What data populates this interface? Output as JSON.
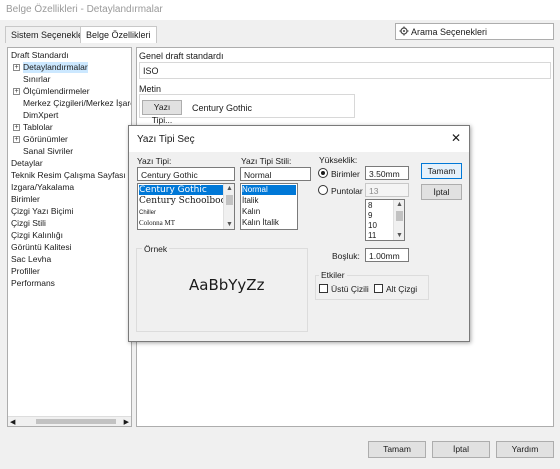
{
  "window": {
    "title": "Belge Özellikleri - Detaylandırmalar"
  },
  "tabs": [
    {
      "label": "Sistem Seçenekleri"
    },
    {
      "label": "Belge Özellikleri"
    }
  ],
  "search": {
    "placeholder": "Arama Seçenekleri"
  },
  "tree": [
    {
      "label": "Draft Standardı"
    },
    {
      "label": "Detaylandırmalar"
    },
    {
      "label": "Sınırlar"
    },
    {
      "label": "Ölçümlendirmeler"
    },
    {
      "label": "Merkez Çizgileri/Merkez İşare"
    },
    {
      "label": "DimXpert"
    },
    {
      "label": "Tablolar"
    },
    {
      "label": "Görünümler"
    },
    {
      "label": "Sanal Sivriler"
    },
    {
      "label": "Detaylar"
    },
    {
      "label": "Teknik Resim Çalışma Sayfası"
    },
    {
      "label": "Izgara/Yakalama"
    },
    {
      "label": "Birimler"
    },
    {
      "label": "Çizgi Yazı Biçimi"
    },
    {
      "label": "Çizgi Stili"
    },
    {
      "label": "Çizgi Kalınlığı"
    },
    {
      "label": "Görüntü Kalitesi"
    },
    {
      "label": "Sac Levha"
    },
    {
      "label": "Profiller"
    },
    {
      "label": "Performans"
    }
  ],
  "main": {
    "general_label": "Genel draft standardı",
    "general_value": "ISO",
    "text_label": "Metin",
    "font_button": "Yazı Tipi...",
    "font_value": "Century Gothic"
  },
  "dialog": {
    "title": "Yazı Tipi Seç",
    "font_label": "Yazı Tipi:",
    "font_value": "Century Gothic",
    "fonts": [
      "Century Gothic",
      "Century Schoolbook",
      "Chiller",
      "Colonna MT"
    ],
    "style_label": "Yazı Tipi Stili:",
    "style_value": "Normal",
    "styles": [
      "Normal",
      "İtalik",
      "Kalın",
      "Kalın İtalik"
    ],
    "height_label": "Yükseklik:",
    "units_label": "Birimler",
    "units_value": "3.50mm",
    "points_label": "Puntolar",
    "points_value": "13",
    "points_list": [
      "8",
      "9",
      "10",
      "11"
    ],
    "spacing_label": "Boşluk:",
    "spacing_value": "1.00mm",
    "preview_label": "Örnek",
    "preview_text": "AaBbYyZz",
    "effects_label": "Etkiler",
    "strike_label": "Üstü Çizili",
    "underline_label": "Alt Çizgi",
    "ok": "Tamam",
    "cancel": "İptal"
  },
  "footer": {
    "ok": "Tamam",
    "cancel": "İptal",
    "help": "Yardım"
  },
  "colors": {
    "selection": "#0078d7",
    "tree_selection": "#cce8ff",
    "accent_border": "#0078d7"
  }
}
